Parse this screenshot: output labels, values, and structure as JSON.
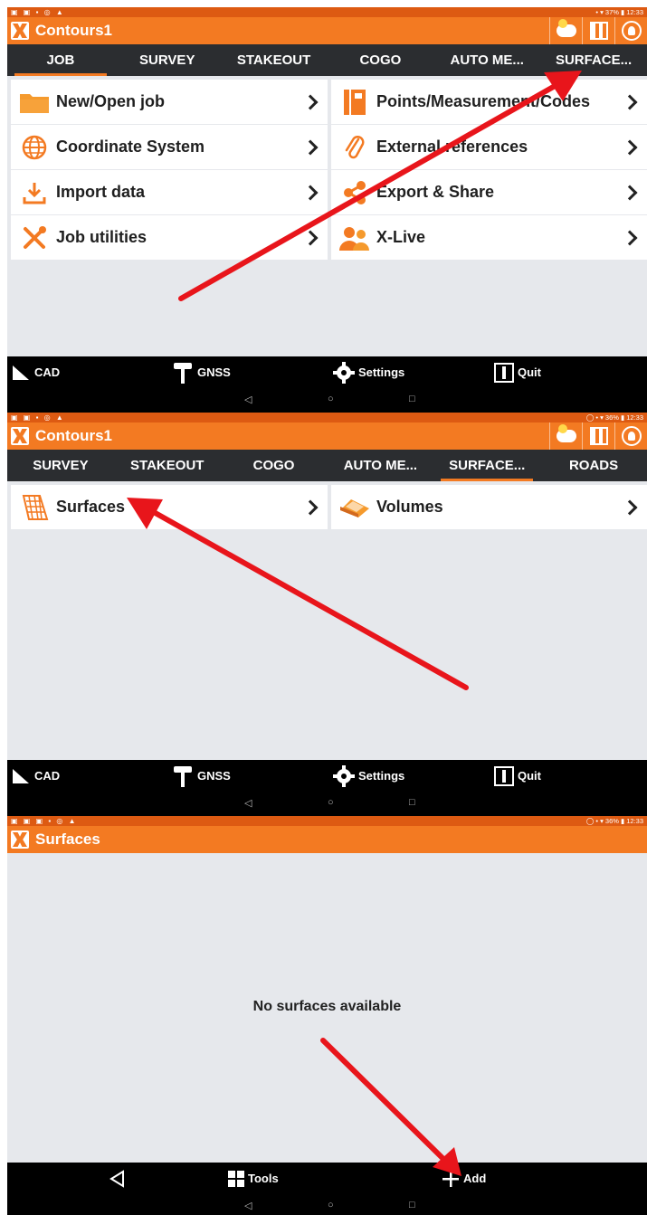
{
  "statusbar_1": {
    "icons": "▣ ▣ ▪ ◎ ▲",
    "right": "• ▾ 37% ▮ 12:33"
  },
  "statusbar_2": {
    "icons": "▣ ▣ ▪ ◎ ▲",
    "right": "◯ • ▾ 36% ▮ 12:33"
  },
  "statusbar_3": {
    "icons": "▣ ▣ ▣ ▪ ◎ ▲",
    "right": "◯ • ▾ 36% ▮ 12:33"
  },
  "screen1": {
    "title": "Contours1",
    "tabs": [
      {
        "label": "JOB",
        "active": true
      },
      {
        "label": "SURVEY",
        "active": false
      },
      {
        "label": "STAKEOUT",
        "active": false
      },
      {
        "label": "COGO",
        "active": false
      },
      {
        "label": "AUTO ME...",
        "active": false
      },
      {
        "label": "SURFACE...",
        "active": false
      }
    ],
    "menu": [
      {
        "label": "New/Open job",
        "icon": "folder-icon"
      },
      {
        "label": "Points/Measurement/Codes",
        "icon": "notebook-icon"
      },
      {
        "label": "Coordinate System",
        "icon": "globe-icon"
      },
      {
        "label": "External references",
        "icon": "paperclip-icon"
      },
      {
        "label": "Import data",
        "icon": "download-icon"
      },
      {
        "label": "Export & Share",
        "icon": "share-icon"
      },
      {
        "label": "Job utilities",
        "icon": "tools-icon"
      },
      {
        "label": "X-Live",
        "icon": "people-icon"
      }
    ]
  },
  "screen2": {
    "title": "Contours1",
    "tabs": [
      {
        "label": "SURVEY",
        "active": false
      },
      {
        "label": "STAKEOUT",
        "active": false
      },
      {
        "label": "COGO",
        "active": false
      },
      {
        "label": "AUTO ME...",
        "active": false
      },
      {
        "label": "SURFACE...",
        "active": true
      },
      {
        "label": "ROADS",
        "active": false
      }
    ],
    "menu": [
      {
        "label": "Surfaces",
        "icon": "surface-grid-icon"
      },
      {
        "label": "Volumes",
        "icon": "volume-icon"
      }
    ]
  },
  "screen3": {
    "title": "Surfaces",
    "empty_message": "No surfaces available",
    "bottom": {
      "tools": "Tools",
      "add": "Add"
    }
  },
  "bottombar": {
    "cad": "CAD",
    "gnss": "GNSS",
    "settings": "Settings",
    "quit": "Quit"
  },
  "navbar": {
    "back": "◁",
    "home": "○",
    "recent": "□"
  },
  "colors": {
    "accent": "#f37a22",
    "statusbar": "#dd5a12",
    "tabbar": "#2b2d30",
    "annotation_arrow": "#e8151b"
  }
}
